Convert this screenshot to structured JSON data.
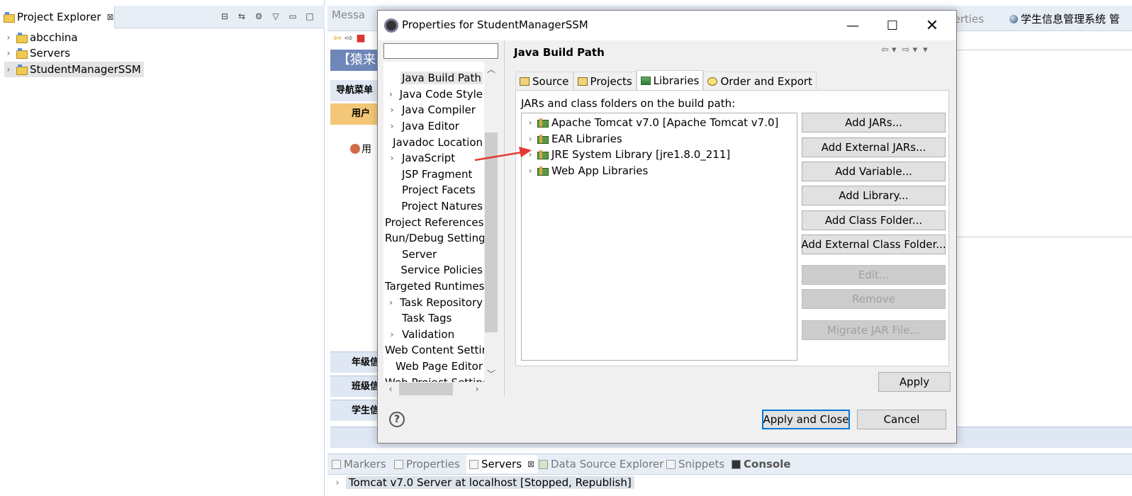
{
  "explorer": {
    "tab_label": "Project Explorer",
    "tab_close": "⊠",
    "items": [
      {
        "label": "abcchina"
      },
      {
        "label": "Servers"
      },
      {
        "label": "StudentManagerSSM"
      }
    ]
  },
  "background_editor": {
    "tab_messages": "Messa",
    "tab_properties": "perties",
    "tab_system": "学生信息管理系统 管",
    "banner": "【猿来",
    "menu_header": "导航菜单",
    "user_tab": "用户",
    "user_item": "用",
    "sections": [
      "年级信",
      "班级信",
      "学生信"
    ]
  },
  "bottom_views": {
    "tabs": [
      {
        "label": "Markers",
        "active": false
      },
      {
        "label": "Properties",
        "active": false
      },
      {
        "label": "Servers",
        "active": true,
        "close": "⊠"
      },
      {
        "label": "Data Source Explorer",
        "active": false
      },
      {
        "label": "Snippets",
        "active": false
      },
      {
        "label": "Console",
        "active": false
      }
    ],
    "server_row": "Tomcat v7.0 Server at localhost  [Stopped, Republish]"
  },
  "dialog": {
    "title": "Properties for StudentManagerSSM",
    "filter_value": "",
    "nav_items": [
      {
        "label": "Java Build Path",
        "expandable": false,
        "selected": true
      },
      {
        "label": "Java Code Style",
        "expandable": true
      },
      {
        "label": "Java Compiler",
        "expandable": true
      },
      {
        "label": "Java Editor",
        "expandable": true
      },
      {
        "label": "Javadoc Location",
        "expandable": false
      },
      {
        "label": "JavaScript",
        "expandable": true
      },
      {
        "label": "JSP Fragment",
        "expandable": false
      },
      {
        "label": "Project Facets",
        "expandable": false
      },
      {
        "label": "Project Natures",
        "expandable": false
      },
      {
        "label": "Project References",
        "expandable": false
      },
      {
        "label": "Run/Debug Settings",
        "expandable": false
      },
      {
        "label": "Server",
        "expandable": false
      },
      {
        "label": "Service Policies",
        "expandable": false
      },
      {
        "label": "Targeted Runtimes",
        "expandable": false
      },
      {
        "label": "Task Repository",
        "expandable": true
      },
      {
        "label": "Task Tags",
        "expandable": false
      },
      {
        "label": "Validation",
        "expandable": true
      },
      {
        "label": "Web Content Settings",
        "expandable": false
      },
      {
        "label": "Web Page Editor",
        "expandable": false
      },
      {
        "label": "Web Project Settings",
        "expandable": false
      }
    ],
    "content_title": "Java Build Path",
    "tabs": [
      {
        "label": "Source",
        "active": false
      },
      {
        "label": "Projects",
        "active": false
      },
      {
        "label": "Libraries",
        "active": true
      },
      {
        "label": "Order and Export",
        "active": false
      }
    ],
    "libraries_caption": "JARs and class folders on the build path:",
    "libraries": [
      {
        "label": "Apache Tomcat v7.0 [Apache Tomcat v7.0]"
      },
      {
        "label": "EAR Libraries"
      },
      {
        "label": "JRE System Library [jre1.8.0_211]"
      },
      {
        "label": "Web App Libraries"
      }
    ],
    "buttons": {
      "add_jars": "Add JARs...",
      "add_external_jars": "Add External JARs...",
      "add_variable": "Add Variable...",
      "add_library": "Add Library...",
      "add_class_folder": "Add Class Folder...",
      "add_external_class_folder": "Add External Class Folder...",
      "edit": "Edit...",
      "remove": "Remove",
      "migrate_jar": "Migrate JAR File...",
      "apply": "Apply",
      "apply_and_close": "Apply and Close",
      "cancel": "Cancel"
    },
    "help": "?"
  },
  "colors": {
    "annotation_arrow": "#e53935",
    "primary_border": "#0078d7"
  }
}
